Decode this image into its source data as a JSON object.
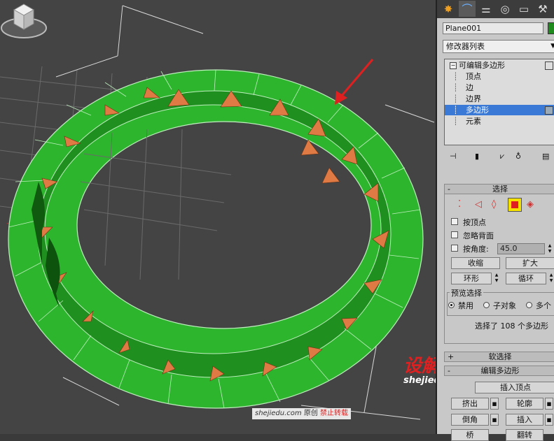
{
  "panel": {
    "tabs": [
      {
        "name": "create-tab",
        "icon": "sun-icon",
        "glyph": "✸",
        "color": "#f0a020"
      },
      {
        "name": "modify-tab",
        "icon": "bend-curve-icon",
        "glyph": "⌒",
        "color": "#6ab0ff"
      },
      {
        "name": "hierarchy-tab",
        "icon": "hierarchy-icon",
        "glyph": "⚌",
        "color": "#dddddd"
      },
      {
        "name": "motion-tab",
        "icon": "motion-wheel-icon",
        "glyph": "◎",
        "color": "#dddddd"
      },
      {
        "name": "display-tab",
        "icon": "display-monitor-icon",
        "glyph": "▭",
        "color": "#dddddd"
      },
      {
        "name": "utilities-tab",
        "icon": "hammer-icon",
        "glyph": "⚒",
        "color": "#dddddd"
      }
    ],
    "object_name": "Plane001",
    "object_color": "#1e8a1e",
    "modifier_list": "修改器列表",
    "stack": {
      "root": "可编辑多边形",
      "items": [
        "顶点",
        "边",
        "边界",
        "多边形",
        "元素"
      ],
      "selected_index": 3
    },
    "selection": {
      "title": "选择",
      "collapse_sign": "-",
      "by_vertex": "按顶点",
      "ignore_backfacing": "忽略背面",
      "by_angle": "按角度:",
      "angle_value": "45.0",
      "shrink": "收缩",
      "grow": "扩大",
      "ring": "环形",
      "loop": "循环",
      "preview_group": "预览选择",
      "preview_off": "禁用",
      "preview_subobject": "子对象",
      "preview_multi": "多个",
      "status": "选择了 108 个多边形"
    },
    "soft_selection": {
      "title": "软选择",
      "expand_sign": "+"
    },
    "edit_polygons": {
      "title": "编辑多边形",
      "insert_vertex": "插入顶点",
      "extrude": "挤出",
      "outline": "轮廓",
      "bevel": "倒角",
      "inset": "插入",
      "bridge": "桥",
      "flip": "翻转"
    }
  },
  "watermark": {
    "logo_text": "设解读",
    "logo_url": "shejiedu.com",
    "footer_url": "shejiedu.com",
    "footer_original": "原创",
    "footer_warning": "禁止转载"
  },
  "colors": {
    "viewport_bg": "#444444",
    "mesh_green": "#2db52d",
    "mesh_dark_green": "#1f8f1f",
    "selected_face": "#e07a45",
    "highlight_blue": "#3a7ad6",
    "arrow_red": "#e02020"
  }
}
